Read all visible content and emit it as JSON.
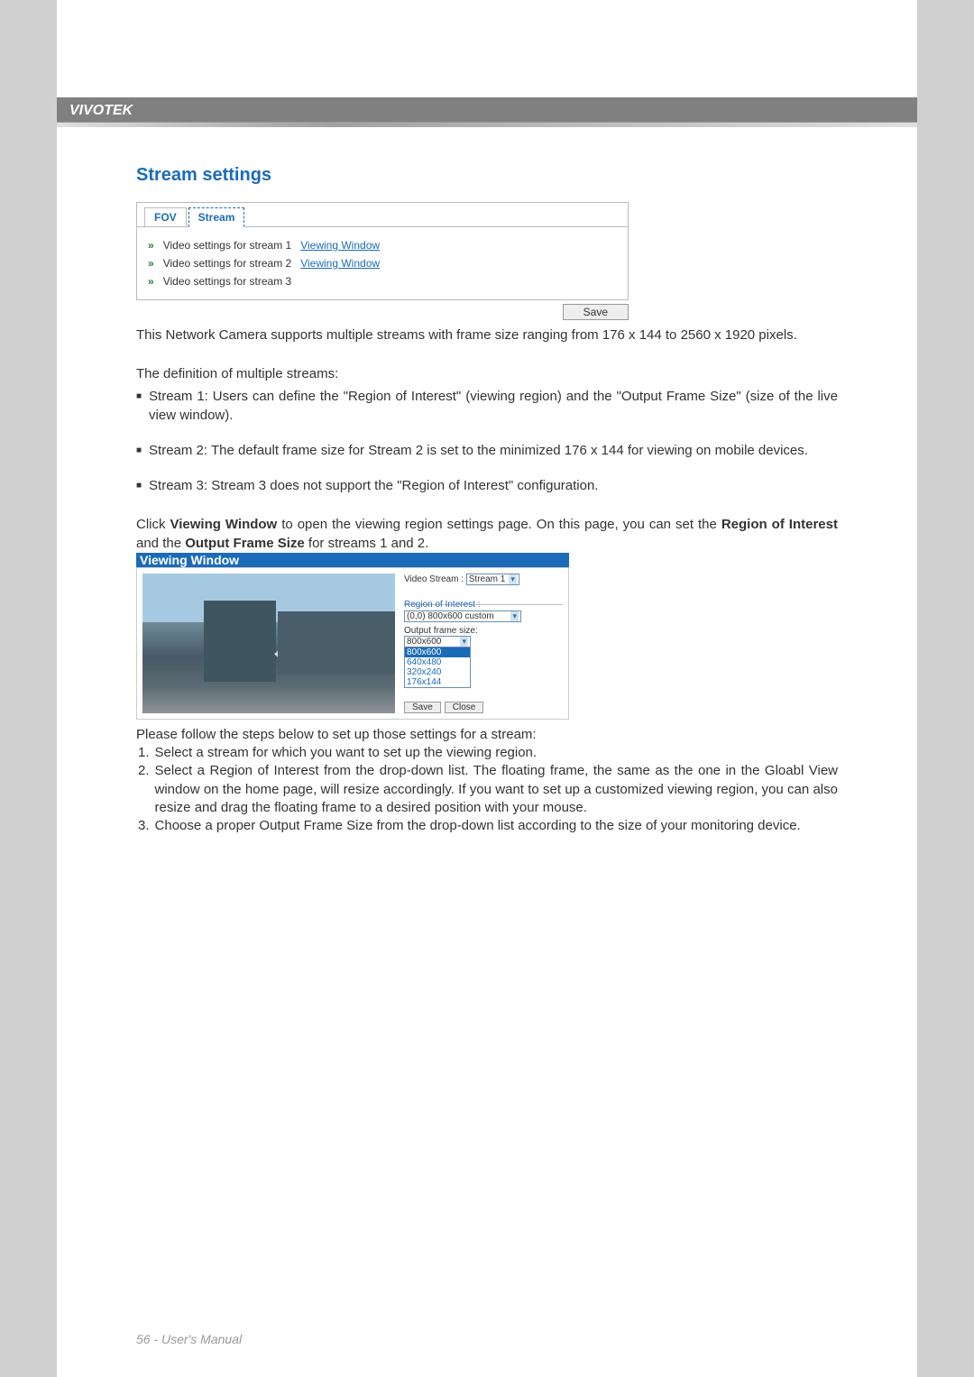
{
  "header": {
    "brand": "VIVOTEK"
  },
  "section_title": "Stream settings",
  "tabs": {
    "fov": "FOV",
    "stream": "Stream"
  },
  "stream_rows": [
    {
      "label": "Video settings for stream 1",
      "link": "Viewing Window"
    },
    {
      "label": "Video settings for stream 2",
      "link": "Viewing Window"
    },
    {
      "label": "Video settings for stream 3",
      "link": ""
    }
  ],
  "save_button": "Save",
  "intro_text": "This Network Camera supports multiple streams with frame size ranging from 176 x 144 to 2560 x 1920 pixels.",
  "def_heading": "The definition of multiple streams:",
  "bullets": [
    "Stream 1: Users can define the \"Region of Interest\" (viewing region) and the \"Output Frame Size\" (size of the live view window).",
    "Stream 2: The default frame size for Stream 2 is set to the minimized 176 x 144 for viewing on mobile devices.",
    "Stream 3: Stream 3 does not support the \"Region of Interest\" configuration."
  ],
  "click_para": {
    "pre": "Click ",
    "bold1": "Viewing Window",
    "mid1": " to open the viewing region settings page. On this page, you can set the ",
    "bold2": "Region of Interest",
    "mid2": " and the ",
    "bold3": "Output Frame Size",
    "post": " for streams 1 and 2."
  },
  "vw": {
    "title": "Viewing Window",
    "video_stream_label": "Video Stream :",
    "video_stream_value": "Stream 1",
    "roi_label": "Region of Interest :",
    "roi_value": "(0,0) 800x600 custom",
    "ofs_label": "Output frame size:",
    "ofs_value": "800x600",
    "ofs_options": [
      "800x600",
      "640x480",
      "320x240",
      "176x144"
    ],
    "save": "Save",
    "close": "Close"
  },
  "steps_heading": "Please follow the steps below to set up those settings for a stream:",
  "steps": [
    {
      "num": "1.",
      "pre": "Select a stream for which you want to set up the viewing region.",
      "bold": "",
      "post": ""
    },
    {
      "num": "2.",
      "pre": "Select a ",
      "bold": "Region of Interest",
      "post": " from the drop-down list. The floating frame, the same as the one in the Gloabl View window on the home page, will resize accordingly. If you want to set up a customized viewing region, you can also resize and drag the floating frame to a desired position with your mouse."
    },
    {
      "num": "3.",
      "pre": "Choose a proper ",
      "bold": "Output Frame Size",
      "post": " from the drop-down list according to the size of your monitoring device."
    }
  ],
  "footer": {
    "page": "56",
    "sep": " - ",
    "title": "User's Manual"
  }
}
